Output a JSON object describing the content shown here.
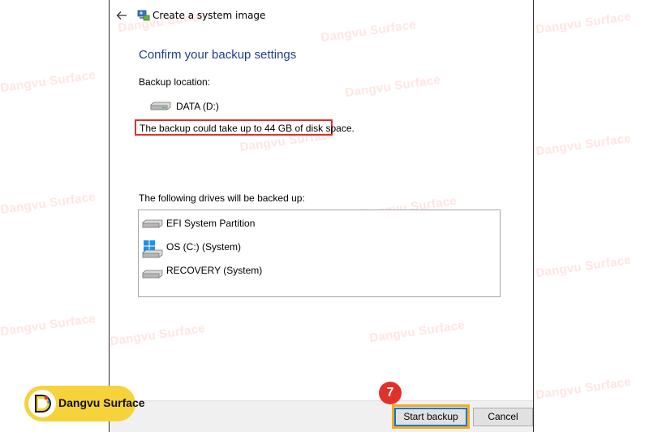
{
  "window": {
    "title": "Create a system image"
  },
  "page": {
    "heading": "Confirm your backup settings",
    "backup_location_label": "Backup location:",
    "backup_location_drive": "DATA (D:)",
    "space_warning": "The backup could take up to 44 GB of disk space.",
    "drives_label": "The following drives will be backed up:",
    "drives": [
      {
        "label": "EFI System Partition",
        "icon": "drive-icon"
      },
      {
        "label": "OS (C:) (System)",
        "icon": "windows-icon"
      },
      {
        "label": "RECOVERY (System)",
        "icon": "drive-icon"
      }
    ]
  },
  "footer": {
    "start_label": "Start backup",
    "cancel_label": "Cancel"
  },
  "annotations": {
    "step_number": "7",
    "highlight_color": "#f3ab1f",
    "warning_border_color": "#e0312a"
  },
  "branding": {
    "name": "Dangvu Surface",
    "watermark": "Dangvu Surface"
  }
}
